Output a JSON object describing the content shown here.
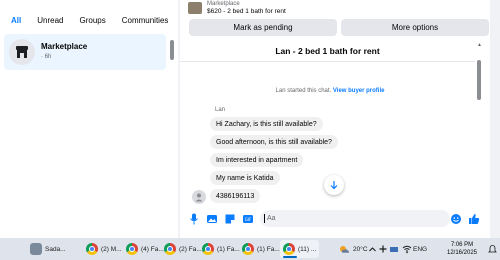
{
  "left_panel": {
    "filters": [
      "All",
      "Unread",
      "Groups",
      "Communities"
    ],
    "chat": {
      "name": "Marketplace",
      "time": "· 6h"
    }
  },
  "header": {
    "marketplace_label": "Marketplace",
    "listing_summary": "$620 - 2 bed 1 bath for rent",
    "mark_pending_label": "Mark as pending",
    "more_options_label": "More options"
  },
  "conversation": {
    "title": "Lan - 2 bed 1 bath for rent",
    "system_text": "Lan started this chat.",
    "system_link": "View buyer profile",
    "sender": "Lan",
    "messages": [
      "Hi Zachary, is this still available?",
      "Good afternoon, is this still available?",
      "Im interested in apartment",
      "My name is Katida",
      "4386196113"
    ]
  },
  "composer": {
    "placeholder": "Aa"
  },
  "taskbar": {
    "apps": [
      "Sada...",
      "(2) M...",
      "(4) Fa...",
      "(2) Fa...",
      "(1) Fa...",
      "(1) Fa...",
      "(11) ..."
    ],
    "weather": "20°C",
    "language": "ENG",
    "time": "7:06 PM",
    "date": "12/16/2025"
  },
  "colors": {
    "accent": "#0a7cff",
    "bubble": "#f0f0f0",
    "panel_bg": "#f0f2f5"
  }
}
